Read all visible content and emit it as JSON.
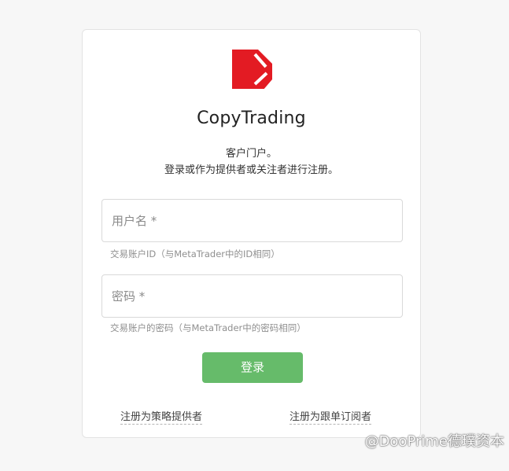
{
  "brand": {
    "title": "CopyTrading",
    "accent": "#e31b23"
  },
  "intro": {
    "line1": "客户门户。",
    "line2": "登录或作为提供者或关注者进行注册。"
  },
  "form": {
    "username_placeholder": "用户名 *",
    "username_hint": "交易账户ID（与MetaTrader中的ID相同）",
    "password_placeholder": "密码 *",
    "password_hint": "交易账户的密码（与MetaTrader中的密码相同）",
    "login_label": "登录"
  },
  "links": {
    "register_provider": "注册为策略提供者",
    "register_follower": "注册为跟单订阅者"
  },
  "watermark": "@DooPrime德璞资本",
  "colors": {
    "login_button": "#66bb6a",
    "page_background": "#f7f7f7"
  }
}
